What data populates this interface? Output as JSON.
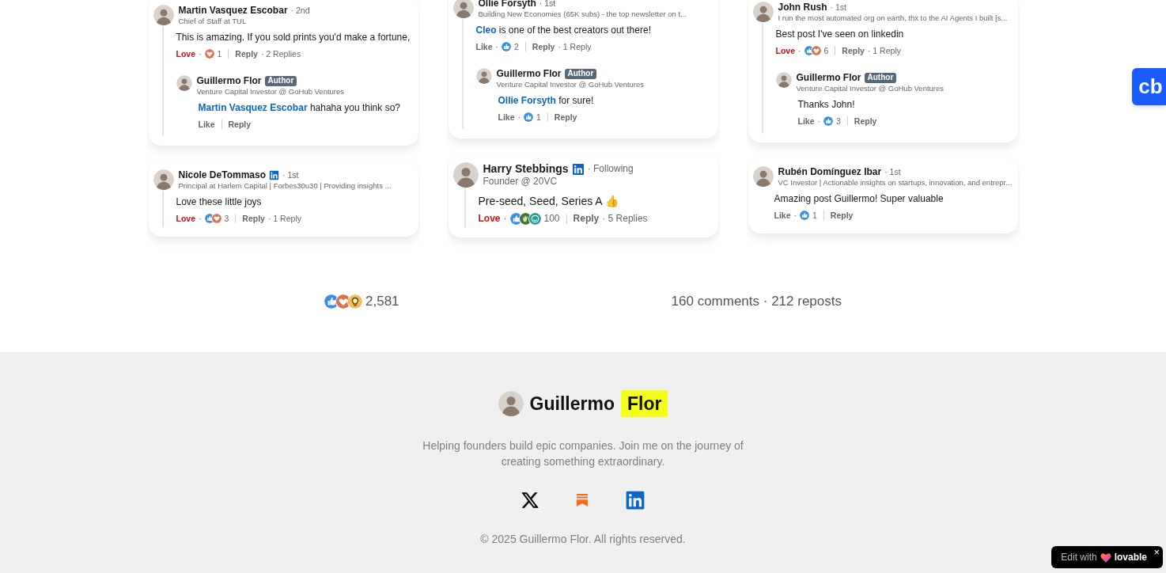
{
  "comment_columns": [
    {
      "comments": [
        {
          "name": "Martin Vasquez Escobar",
          "linkedin_badge": false,
          "relation": "· 2nd",
          "headline": "Chief of Staff at TUL",
          "text": "This is amazing. If you sold prints you'd make a fortune,",
          "reaction_label": "Love",
          "reacted": true,
          "reaction_sep": "·",
          "reaction_icons": [
            {
              "kind": "love"
            }
          ],
          "count": "1",
          "reply_label": "Reply",
          "replies": "· 2 Replies",
          "kind": "compact",
          "replies_list": [
            {
              "name": "Guillermo Flor",
              "author_badge": "Author",
              "headline": "Venture Capital Investor @ GoHub Ventures",
              "mention": "Martin Vasquez Escobar",
              "text": "hahaha you think so?",
              "reaction_label": "Like",
              "reacted": false,
              "reply_label": "Reply"
            }
          ]
        },
        {
          "name": "Nicole DeTommaso",
          "linkedin_badge": true,
          "relation": "· 1st",
          "headline": "Principal at Harlem Capital | Forbes30u30 | Providing insights ...",
          "text": "Love these little joys",
          "reaction_label": "Love",
          "reacted": true,
          "reaction_sep": "·",
          "reaction_icons": [
            {
              "kind": "like"
            },
            {
              "kind": "love"
            }
          ],
          "count": "3",
          "reply_label": "Reply",
          "replies": "· 1 Reply",
          "kind": "compact"
        }
      ]
    },
    {
      "comments": [
        {
          "name": "Ollie Forsyth",
          "linkedin_badge": false,
          "relation": "· 1st",
          "headline": "Building New Economies (65K subs) - the top newsletter on t...",
          "mention": "Cleo",
          "text": "is one of the best creators out there!",
          "reaction_label": "Like",
          "reacted": false,
          "reaction_sep": "·",
          "reaction_icons": [
            {
              "kind": "like"
            }
          ],
          "count": "2",
          "reply_label": "Reply",
          "replies": "· 1 Reply",
          "kind": "compact",
          "replies_list": [
            {
              "name": "Guillermo Flor",
              "author_badge": "Author",
              "headline": "Venture Capital Investor @ GoHub Ventures",
              "mention": "Ollie Forsyth",
              "text": "for sure!",
              "reaction_label": "Like",
              "reacted": false,
              "reaction_sep": "·",
              "reaction_icons": [
                {
                  "kind": "like"
                }
              ],
              "count": "1",
              "reply_label": "Reply"
            }
          ]
        },
        {
          "name": "Harry Stebbings",
          "linkedin_badge": true,
          "relation": "· Following",
          "headline": "Founder @ 20VC",
          "text": "Pre-seed, Seed, Series A 👍",
          "reaction_label": "Love",
          "reacted": true,
          "reaction_sep": "·",
          "reaction_icons": [
            {
              "kind": "like"
            },
            {
              "kind": "celebrate"
            },
            {
              "kind": "funny"
            }
          ],
          "count": "100",
          "reply_label": "Reply",
          "replies": "· 5 Replies",
          "kind": "large"
        }
      ]
    },
    {
      "comments": [
        {
          "name": "John Rush",
          "linkedin_badge": false,
          "relation": "· 1st",
          "headline": "I run the most automated org on earth, thx to the AI Agents I built [s...",
          "text": "Best post I've seen on linkedin",
          "reaction_label": "Love",
          "reacted": true,
          "reaction_sep": "·",
          "reaction_icons": [
            {
              "kind": "like"
            },
            {
              "kind": "love"
            }
          ],
          "count": "6",
          "reply_label": "Reply",
          "replies": "· 1 Reply",
          "kind": "compact",
          "replies_list": [
            {
              "name": "Guillermo Flor",
              "author_badge": "Author",
              "headline": "Venture Capital Investor @ GoHub Ventures",
              "text": "Thanks John!",
              "reaction_label": "Like",
              "reacted": false,
              "reaction_sep": "·",
              "reaction_icons": [
                {
                  "kind": "like"
                }
              ],
              "count": "3",
              "reply_label": "Reply"
            }
          ]
        },
        {
          "name": "Rubén Domínguez Ibar",
          "linkedin_badge": false,
          "relation": "· 1st",
          "headline": "VC Investor | Actionable insights on startups, innovation, and entrepr...",
          "text": "Amazing post Guillermo! Super valuable",
          "reaction_label": "Like",
          "reacted": false,
          "reaction_sep": "·",
          "reaction_icons": [
            {
              "kind": "like"
            }
          ],
          "count": "1",
          "reply_label": "Reply",
          "kind": "compact"
        }
      ]
    }
  ],
  "post_stats": {
    "reaction_icons": [
      {
        "kind": "like"
      },
      {
        "kind": "love"
      },
      {
        "kind": "insightful"
      }
    ],
    "reactions_count": "2,581",
    "comments_reposts": "160 comments · 212 reposts"
  },
  "footer": {
    "first_name": "Guillermo",
    "highlighted_name": "Flor",
    "tagline": "Helping founders build epic companies. Join me on the journey of creating something extraordinary.",
    "social_links": [
      {
        "kind": "x"
      },
      {
        "kind": "substack"
      },
      {
        "kind": "linkedin"
      }
    ],
    "copyright": "© 2025 Guillermo Flor. All rights reserved."
  },
  "floating_button": {
    "label": "cb"
  },
  "edit_badge": {
    "label": "Edit with",
    "brand": "lovable",
    "close": "×"
  }
}
